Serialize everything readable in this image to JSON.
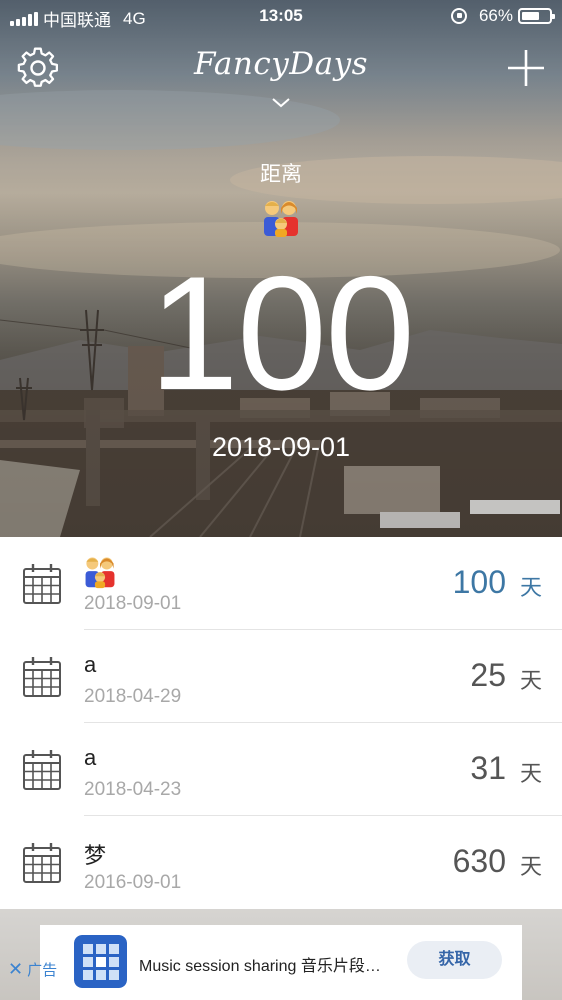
{
  "status_bar": {
    "carrier": "中国联通",
    "network": "4G",
    "time": "13:05",
    "battery": "66%",
    "battery_level": 0.66
  },
  "header": {
    "brand": "FancyDays",
    "settings_icon": "gear-icon",
    "add_icon": "plus-icon",
    "dropdown_icon": "chevron-down-icon"
  },
  "hero": {
    "caption": "距离",
    "emoji": "family-emoji",
    "count": "100",
    "date": "2018-09-01"
  },
  "events": [
    {
      "title": "",
      "emoji": "family-emoji",
      "date": "2018-09-01",
      "count": "100",
      "unit": "天",
      "highlight": true
    },
    {
      "title": "a",
      "date": "2018-04-29",
      "count": "25",
      "unit": "天",
      "highlight": false
    },
    {
      "title": "a",
      "date": "2018-04-23",
      "count": "31",
      "unit": "天",
      "highlight": false
    },
    {
      "title": "梦",
      "date": "2016-09-01",
      "count": "630",
      "unit": "天",
      "highlight": false
    }
  ],
  "ad": {
    "text": "Music session sharing 音乐片段…",
    "button": "获取",
    "close_label": "广告",
    "close_icon": "close-icon"
  },
  "colors": {
    "accent": "#3d77a4",
    "ad_link": "#3b83d0"
  }
}
